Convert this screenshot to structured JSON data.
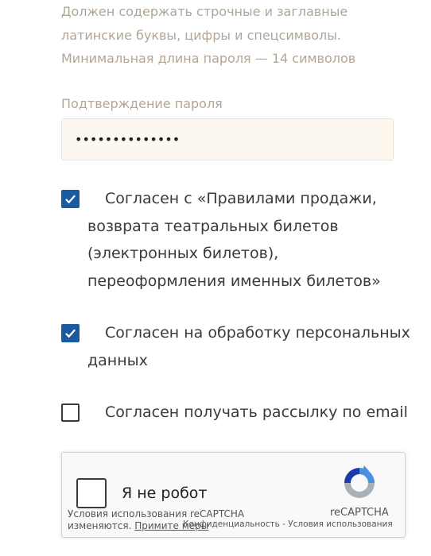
{
  "password_hint": "Должен содержать строчные и заглавные латинские буквы, цифры и спецсимволы. Минимальная длина пароля — 14 символов",
  "confirm_password": {
    "label": "Подтверждение пароля",
    "value": "••••••••••••••"
  },
  "agreements": [
    {
      "label": "Согласен с «Правилами продажи, возврата театральных билетов (электронных билетов), переоформления именных билетов»",
      "checked": true
    },
    {
      "label": "Согласен на обработку персональных данных",
      "checked": true
    },
    {
      "label": "Согласен получать рассылку по email",
      "checked": false
    }
  ],
  "recaptcha": {
    "checkbox_label": "Я не робот",
    "brand": "reCAPTCHA",
    "links": "Конфиденциальность - Условия использования",
    "notice_text": "Условия использования reCAPTCHA изменяются.",
    "notice_link": "Примите меры"
  },
  "colors": {
    "hint_text": "#b3a596",
    "input_bg": "#fdf8ef",
    "checkbox_checked": "#1a5aa0"
  },
  "icons": {
    "check": "checkmark-icon",
    "recaptcha_logo": "recaptcha-logo-icon"
  }
}
